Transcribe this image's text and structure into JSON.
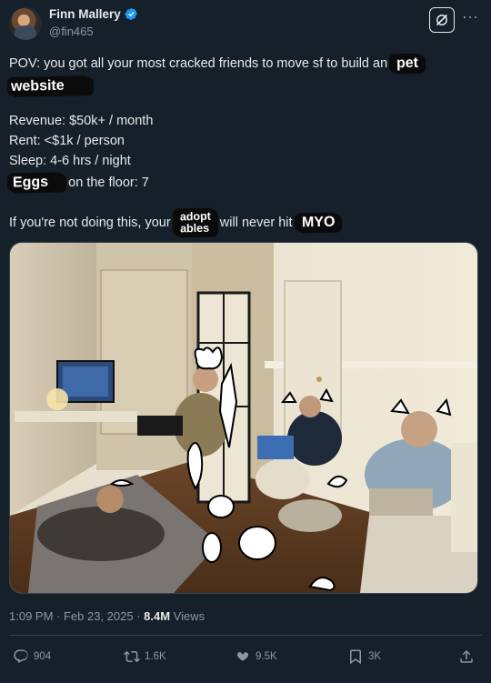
{
  "author": {
    "display_name": "Finn Mallery",
    "handle": "@fin465",
    "verified": true
  },
  "post": {
    "line1_prefix": "POV: you got all your most cracked friends to move sf to build an",
    "line1_overlay": "pet",
    "line2_overlay": "website",
    "revenue": "Revenue: $50k+ / month",
    "rent": "Rent: <$1k / person",
    "sleep": "Sleep: 4-6 hrs / night",
    "eggs_overlay": "Eggs",
    "eggs_suffix": "on the floor: 7",
    "final_prefix": "If you're not doing this, your",
    "final_overlay_top": "adopt",
    "final_overlay_bottom": "ables",
    "final_middle": "will never hit",
    "final_overlay_end": "MYO"
  },
  "meta": {
    "time": "1:09 PM · Feb 23, 2025 · ",
    "views_count": "8.4M",
    "views_label": " Views"
  },
  "actions": {
    "replies": "904",
    "reposts": "1.6K",
    "likes": "9.5K",
    "bookmarks": "3K"
  },
  "colors": {
    "background": "#15202b",
    "text": "#e7e9ea",
    "muted": "#8b98a5",
    "verified": "#1d9bf0"
  }
}
